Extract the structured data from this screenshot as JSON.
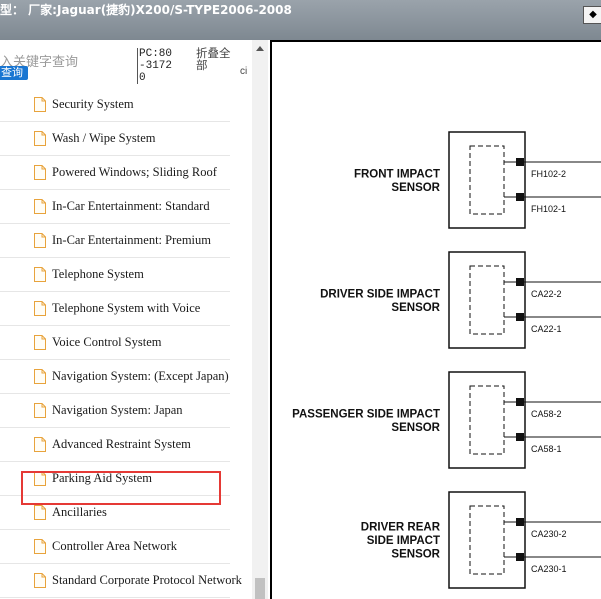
{
  "window": {
    "title": "型： 厂家:Jaguar(捷豹)X200/S-TYPE2006-2008",
    "control_glyph": "◆"
  },
  "toolbar": {
    "search_placeholder": "入关键字查询",
    "query_button": "查询",
    "pc_label": "PC:80-31720",
    "fold_all": "折叠全部",
    "cut_text": "ci"
  },
  "tree": {
    "items": [
      {
        "label": "Security System"
      },
      {
        "label": "Wash / Wipe System"
      },
      {
        "label": "Powered Windows; Sliding Roof"
      },
      {
        "label": "In-Car Entertainment: Standard"
      },
      {
        "label": "In-Car Entertainment: Premium"
      },
      {
        "label": "Telephone System"
      },
      {
        "label": "Telephone System with Voice"
      },
      {
        "label": "Voice Control System"
      },
      {
        "label": "Navigation System: (Except Japan)"
      },
      {
        "label": "Navigation System: Japan"
      },
      {
        "label": "Advanced Restraint System"
      },
      {
        "label": "Parking Aid System"
      },
      {
        "label": "Ancillaries"
      },
      {
        "label": "Controller Area Network"
      },
      {
        "label": "Standard Corporate Protocol Network"
      }
    ],
    "highlighted": "Advanced Restraint System",
    "highlight_color": "#e53935",
    "icon_color": "#e8a33c"
  },
  "diagram": {
    "sensors": [
      {
        "lines": [
          "FRONT IMPACT",
          "SENSOR"
        ],
        "pins": [
          "FH102-2",
          "FH102-1"
        ]
      },
      {
        "lines": [
          "DRIVER SIDE IMPACT",
          "SENSOR"
        ],
        "pins": [
          "CA22-2",
          "CA22-1"
        ]
      },
      {
        "lines": [
          "PASSENGER SIDE IMPACT",
          "SENSOR"
        ],
        "pins": [
          "CA58-2",
          "CA58-1"
        ]
      },
      {
        "lines": [
          "DRIVER REAR",
          "SIDE IMPACT",
          "SENSOR"
        ],
        "pins": [
          "CA230-2",
          "CA230-1"
        ]
      }
    ]
  }
}
